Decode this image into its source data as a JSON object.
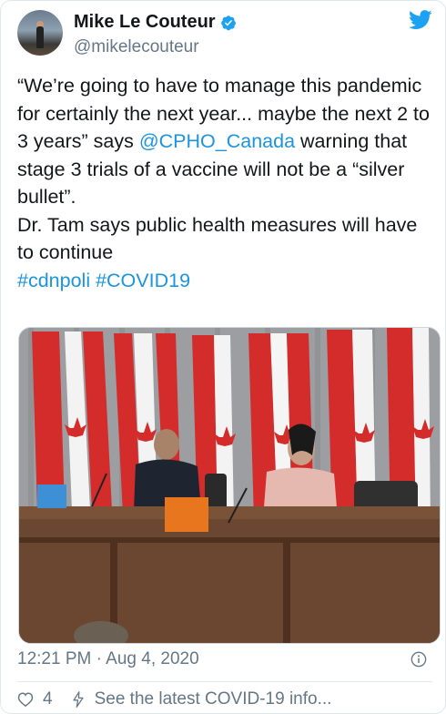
{
  "author": {
    "display_name": "Mike Le Couteur",
    "handle": "@mikelecouteur",
    "verified": true
  },
  "tweet": {
    "text_part1": "“We’re going to have to manage this pandemic for certainly the next year... maybe the next 2 to 3 years” says ",
    "mention": "@CPHO_Canada",
    "text_part2": " warning that stage 3 trials of a vaccine will not be a “silver bullet”.",
    "text_line2": "Dr. Tam says public health measures will have to continue",
    "hashtag1": "#cdnpoli",
    "hashtag2": "#COVID19"
  },
  "meta": {
    "time": "12:21 PM",
    "separator": " · ",
    "date": "Aug 4, 2020"
  },
  "actions": {
    "likes": "4",
    "topic_link": "See the latest COVID-19 info..."
  },
  "icons": {
    "verified": "verified-badge-icon",
    "brand": "twitter-bird-icon",
    "info": "info-icon",
    "like": "heart-icon",
    "topic": "lightning-bolt-icon"
  },
  "colors": {
    "accent": "#1b95e0",
    "brand": "#1da1f2",
    "secondary_text": "#657786",
    "primary_text": "#14171a"
  }
}
